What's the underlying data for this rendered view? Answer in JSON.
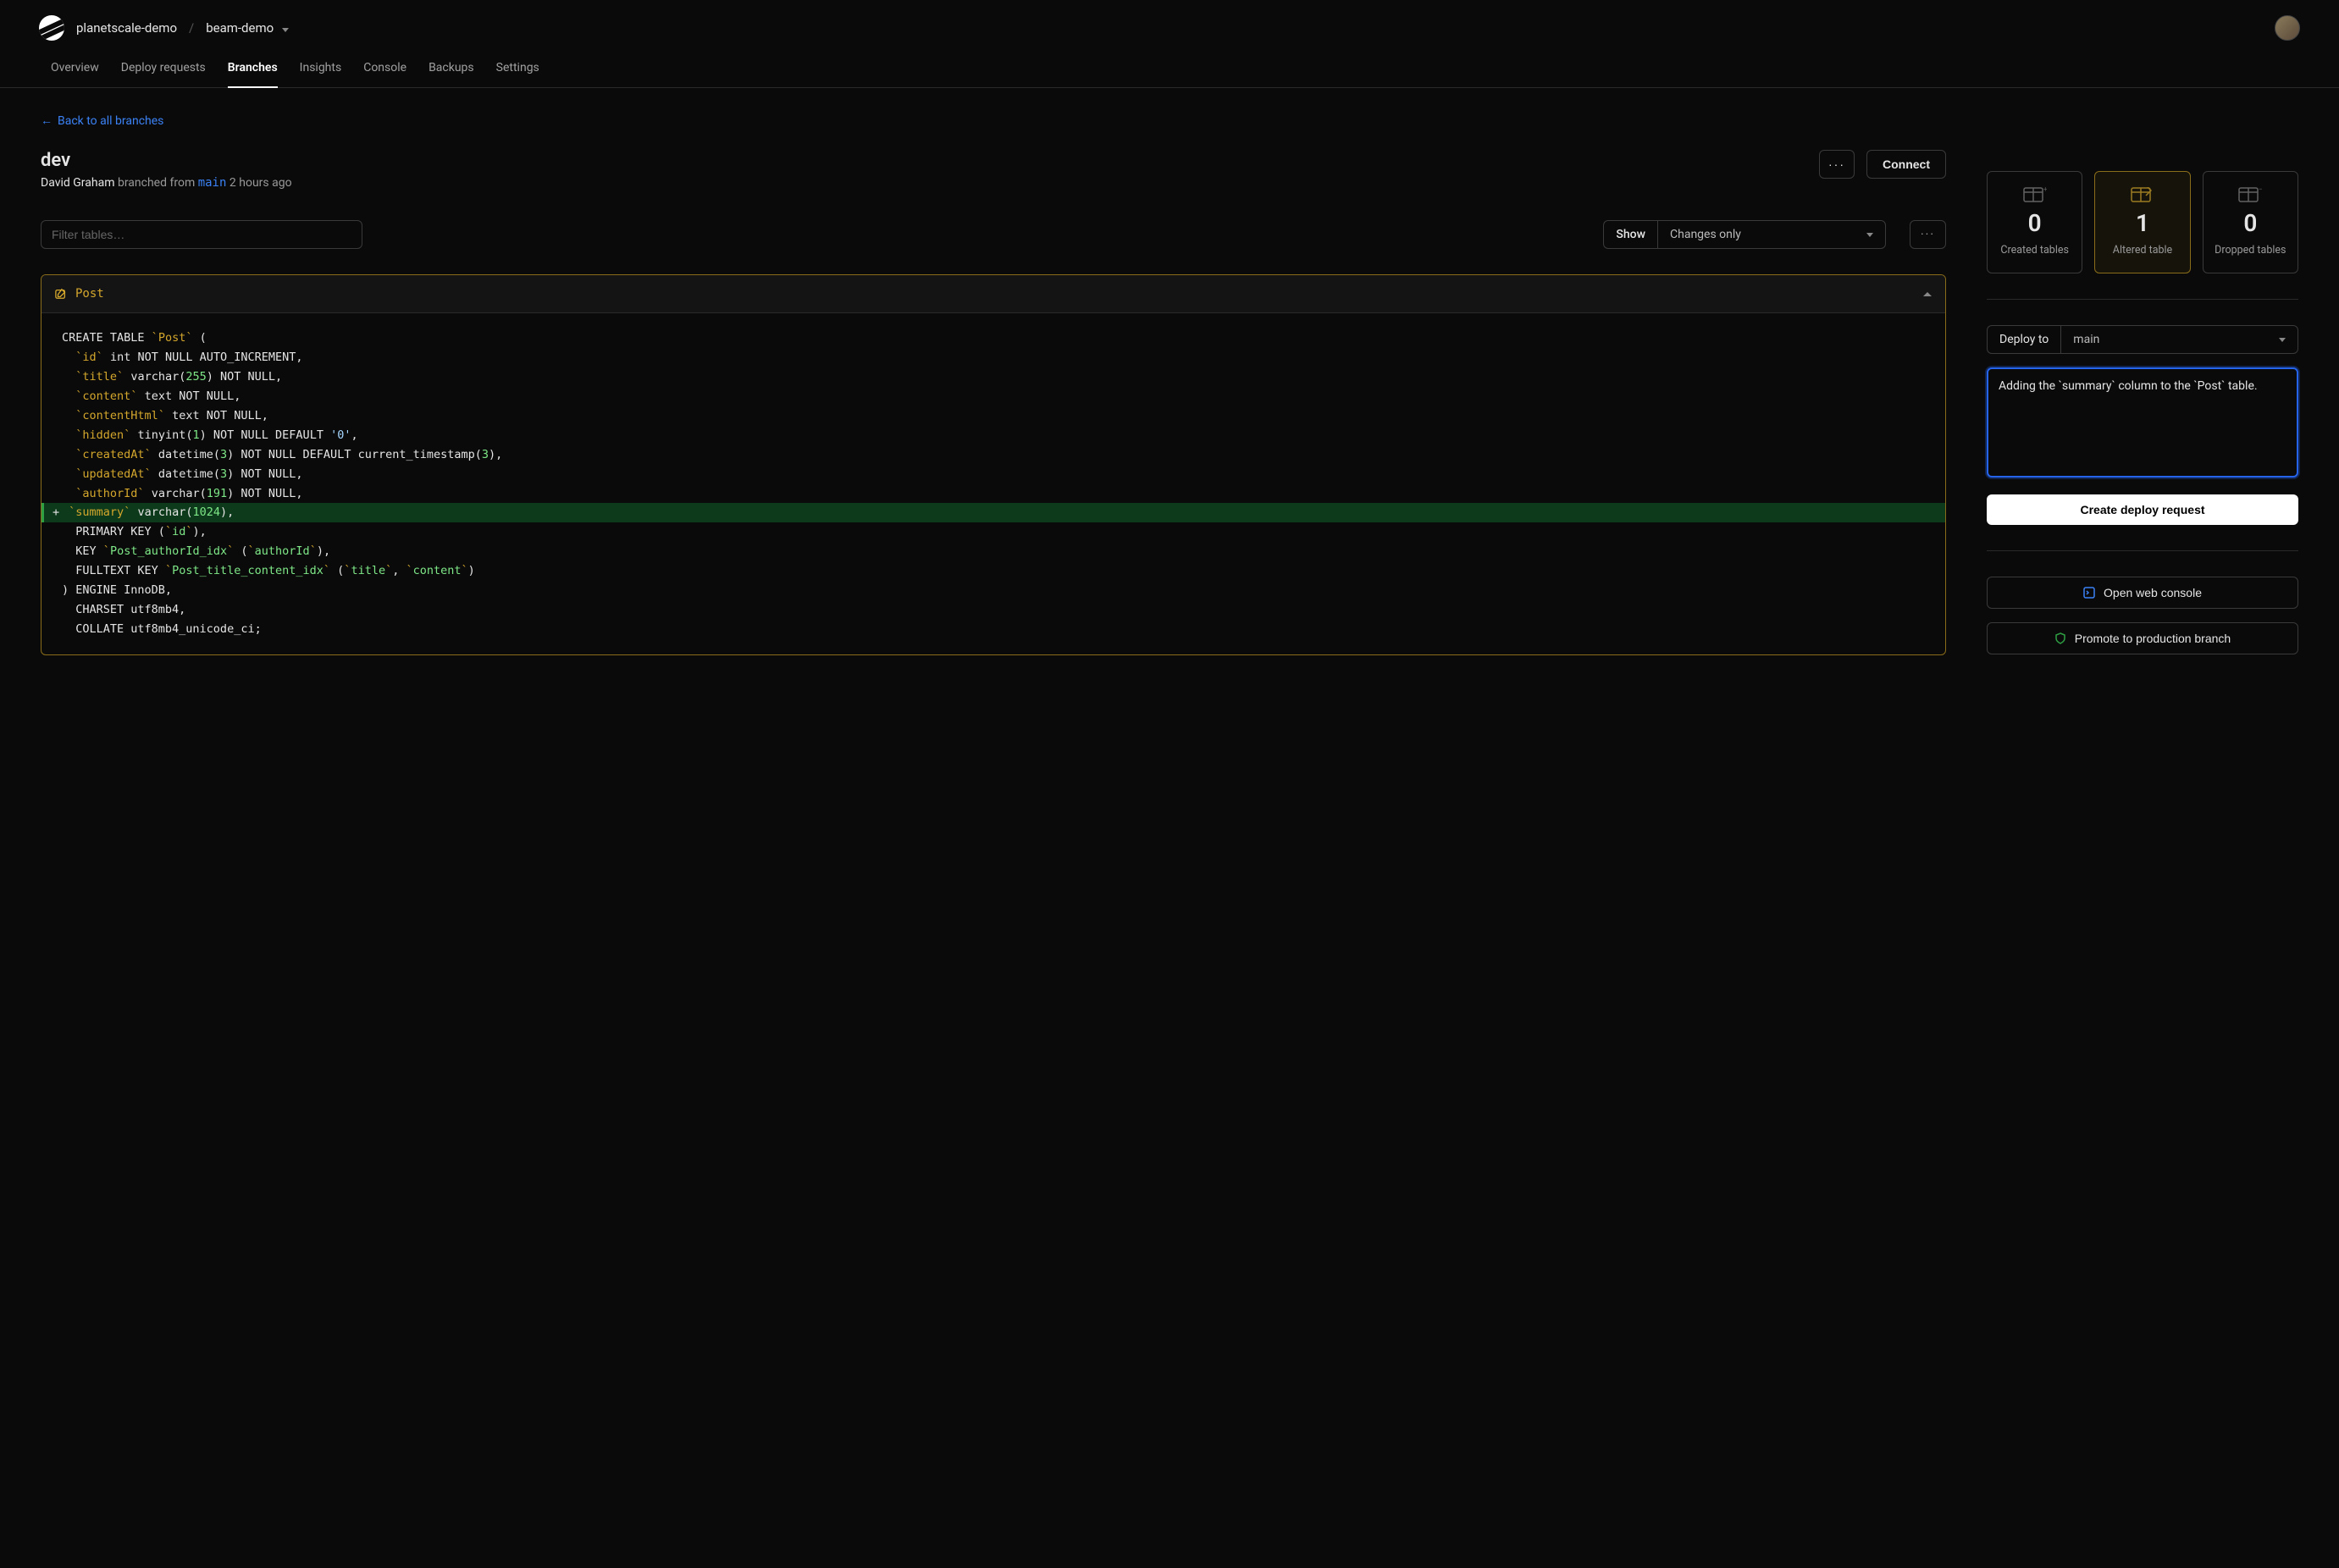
{
  "breadcrumb": {
    "org": "planetscale-demo",
    "db": "beam-demo"
  },
  "tabs": [
    "Overview",
    "Deploy requests",
    "Branches",
    "Insights",
    "Console",
    "Backups",
    "Settings"
  ],
  "active_tab": 2,
  "back_link": "Back to all branches",
  "branch": {
    "name": "dev",
    "user": "David Graham",
    "action": "branched from",
    "parent": "main",
    "when": "2 hours ago"
  },
  "connect_label": "Connect",
  "filter_placeholder": "Filter tables…",
  "show_label": "Show",
  "show_value": "Changes only",
  "table_name": "Post",
  "code": {
    "lines": [
      {
        "t": "plain",
        "html": "CREATE TABLE <span class='tick'>`</span><span class='name'>Post</span><span class='tick'>`</span> ("
      },
      {
        "t": "plain",
        "html": "  <span class='tick'>`</span><span class='name'>id</span><span class='tick'>`</span> int <span class='kw'>NOT NULL</span> AUTO_INCREMENT,"
      },
      {
        "t": "plain",
        "html": "  <span class='tick'>`</span><span class='name'>title</span><span class='tick'>`</span> varchar(<span class='num'>255</span>) <span class='kw'>NOT NULL</span>,"
      },
      {
        "t": "plain",
        "html": "  <span class='tick'>`</span><span class='name'>content</span><span class='tick'>`</span> text <span class='kw'>NOT NULL</span>,"
      },
      {
        "t": "plain",
        "html": "  <span class='tick'>`</span><span class='name'>contentHtml</span><span class='tick'>`</span> text <span class='kw'>NOT NULL</span>,"
      },
      {
        "t": "plain",
        "html": "  <span class='tick'>`</span><span class='name'>hidden</span><span class='tick'>`</span> tinyint(<span class='num'>1</span>) <span class='kw'>NOT NULL</span> DEFAULT <span class='str'>'0'</span>,"
      },
      {
        "t": "plain",
        "html": "  <span class='tick'>`</span><span class='name'>createdAt</span><span class='tick'>`</span> datetime(<span class='num'>3</span>) <span class='kw'>NOT NULL</span> DEFAULT current_timestamp(<span class='num'>3</span>),"
      },
      {
        "t": "plain",
        "html": "  <span class='tick'>`</span><span class='name'>updatedAt</span><span class='tick'>`</span> datetime(<span class='num'>3</span>) <span class='kw'>NOT NULL</span>,"
      },
      {
        "t": "plain",
        "html": "  <span class='tick'>`</span><span class='name'>authorId</span><span class='tick'>`</span> varchar(<span class='num'>191</span>) <span class='kw'>NOT NULL</span>,"
      },
      {
        "t": "added",
        "html": " <span class='tick'>`</span><span class='name'>summary</span><span class='tick'>`</span> varchar(<span class='num'>1024</span>),"
      },
      {
        "t": "plain",
        "html": "  PRIMARY <span class='kw'>KEY</span> (<span class='tick'>`</span><span class='col'>id</span><span class='tick'>`</span>),"
      },
      {
        "t": "plain",
        "html": "  <span class='kw'>KEY</span> <span class='tick'>`</span><span class='idx'>Post_authorId_idx</span><span class='tick'>`</span> (<span class='tick'>`</span><span class='col'>authorId</span><span class='tick'>`</span>),"
      },
      {
        "t": "plain",
        "html": "  FULLTEXT <span class='kw'>KEY</span> <span class='tick'>`</span><span class='idx'>Post_title_content_idx</span><span class='tick'>`</span> (<span class='tick'>`</span><span class='col'>title</span><span class='tick'>`</span>, <span class='tick'>`</span><span class='col'>content</span><span class='tick'>`</span>)"
      },
      {
        "t": "plain",
        "html": ") ENGINE InnoDB,"
      },
      {
        "t": "plain",
        "html": "  CHARSET utf8mb4,"
      },
      {
        "t": "plain",
        "html": "  COLLATE utf8mb4_unicode_ci;"
      }
    ]
  },
  "stats": {
    "created": {
      "num": "0",
      "label": "Created tables"
    },
    "altered": {
      "num": "1",
      "label": "Altered table"
    },
    "dropped": {
      "num": "0",
      "label": "Dropped tables"
    }
  },
  "deploy": {
    "to_label": "Deploy to",
    "target": "main",
    "message": "Adding the `summary` column to the `Post` table.",
    "create_label": "Create deploy request"
  },
  "actions": {
    "open_console": "Open web console",
    "promote": "Promote to production branch"
  }
}
